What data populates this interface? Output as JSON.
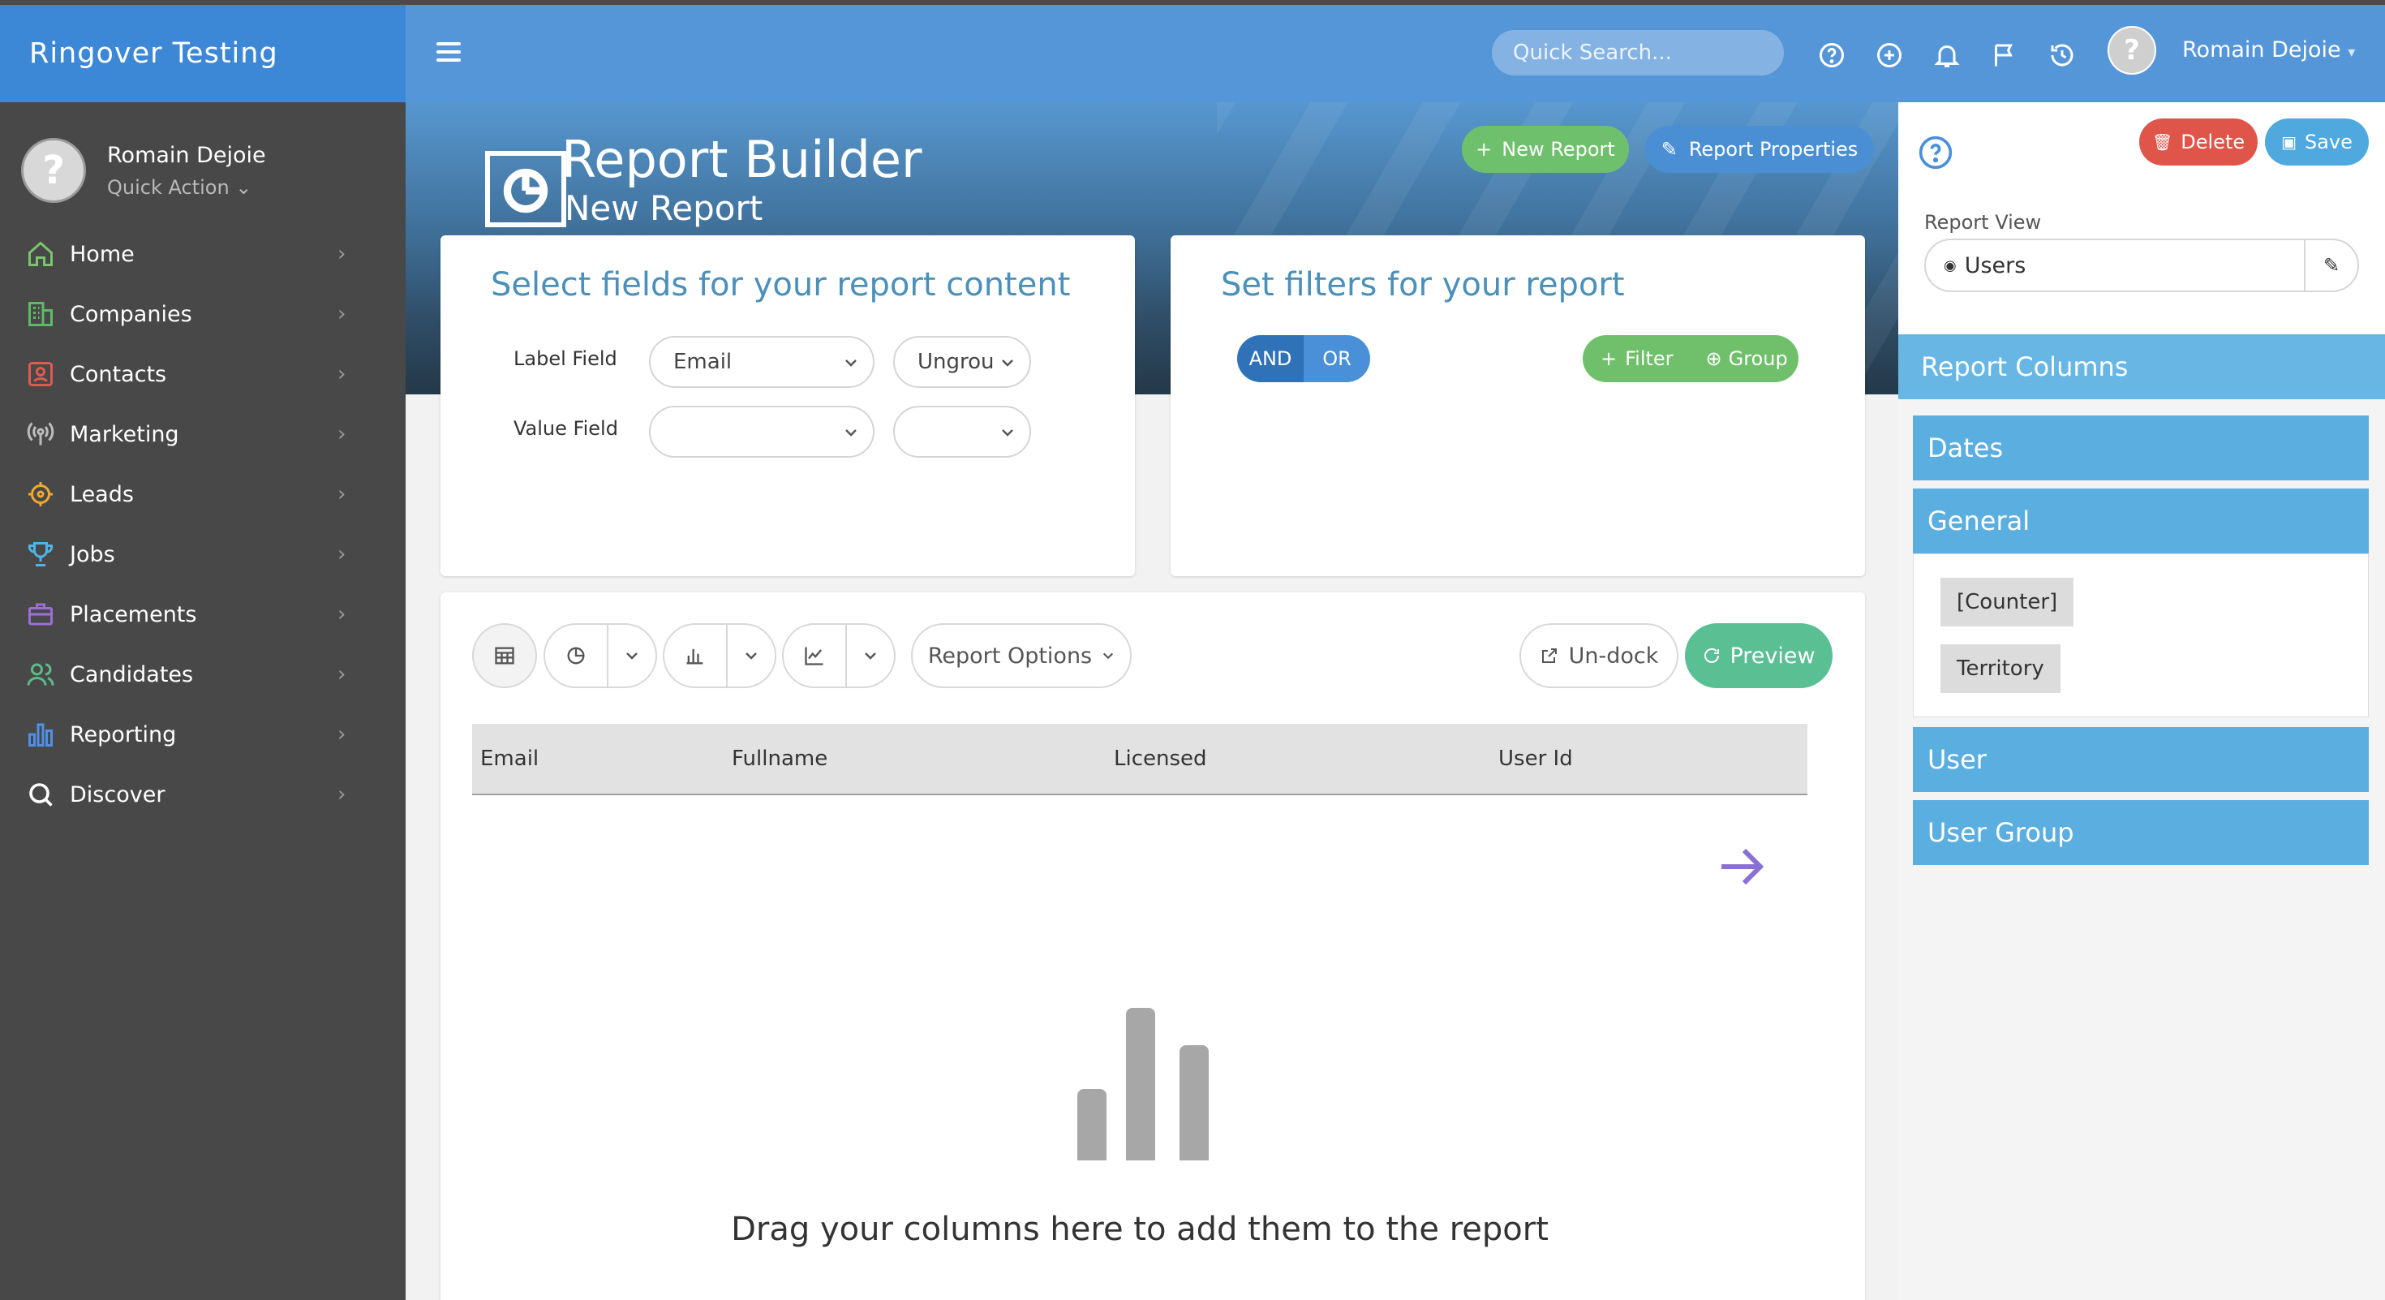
{
  "app": {
    "title": "Ringover Testing"
  },
  "user": {
    "name": "Romain Dejoie",
    "quick_action": "Quick Action"
  },
  "nav": [
    {
      "label": "Home",
      "icon": "home-icon",
      "color": "#7bc46e"
    },
    {
      "label": "Companies",
      "icon": "building-icon",
      "color": "#5dbb63"
    },
    {
      "label": "Contacts",
      "icon": "contact-icon",
      "color": "#e05a4f"
    },
    {
      "label": "Marketing",
      "icon": "broadcast-icon",
      "color": "#bdbdbd"
    },
    {
      "label": "Leads",
      "icon": "crosshair-icon",
      "color": "#f0a830"
    },
    {
      "label": "Jobs",
      "icon": "trophy-icon",
      "color": "#4fb4e8"
    },
    {
      "label": "Placements",
      "icon": "briefcase-icon",
      "color": "#9b6fd6"
    },
    {
      "label": "Candidates",
      "icon": "people-icon",
      "color": "#5dbb87"
    },
    {
      "label": "Reporting",
      "icon": "bar-chart-icon",
      "color": "#4f8fe8"
    },
    {
      "label": "Discover",
      "icon": "search-icon",
      "color": "#ffffff"
    }
  ],
  "header": {
    "search_placeholder": "Quick Search...",
    "user_name": "Romain Dejoie"
  },
  "banner": {
    "title": "Report Builder",
    "subtitle": "New Report",
    "new_report": "New Report",
    "report_properties": "Report Properties"
  },
  "fields_card": {
    "title": "Select fields for your report content",
    "label_field": "Label Field",
    "value_field": "Value Field",
    "label_select": "Email",
    "label_group_select": "Ungrou",
    "value_select": "",
    "value_group_select": ""
  },
  "filters_card": {
    "title": "Set filters for your report",
    "and": "AND",
    "or": "OR",
    "filter": "Filter",
    "group": "Group"
  },
  "toolbar": {
    "report_options": "Report Options",
    "undock": "Un-dock",
    "preview": "Preview"
  },
  "grid": {
    "columns": [
      "Email",
      "Fullname",
      "Licensed",
      "User Id"
    ]
  },
  "drop_hint": "Drag your columns here to add them to the report",
  "right_panel": {
    "delete": "Delete",
    "save": "Save",
    "report_view_label": "Report View",
    "report_view_value": "Users",
    "report_columns": "Report Columns",
    "sections": [
      "Dates",
      "General",
      "User",
      "User Group"
    ],
    "general_tags": [
      "[Counter]",
      "Territory"
    ]
  },
  "colors": {
    "accent": "#5596d8",
    "green": "#70c06b",
    "red": "#e0554a",
    "teal": "#5bbf94",
    "purple_arrow": "#8a6fd6"
  }
}
